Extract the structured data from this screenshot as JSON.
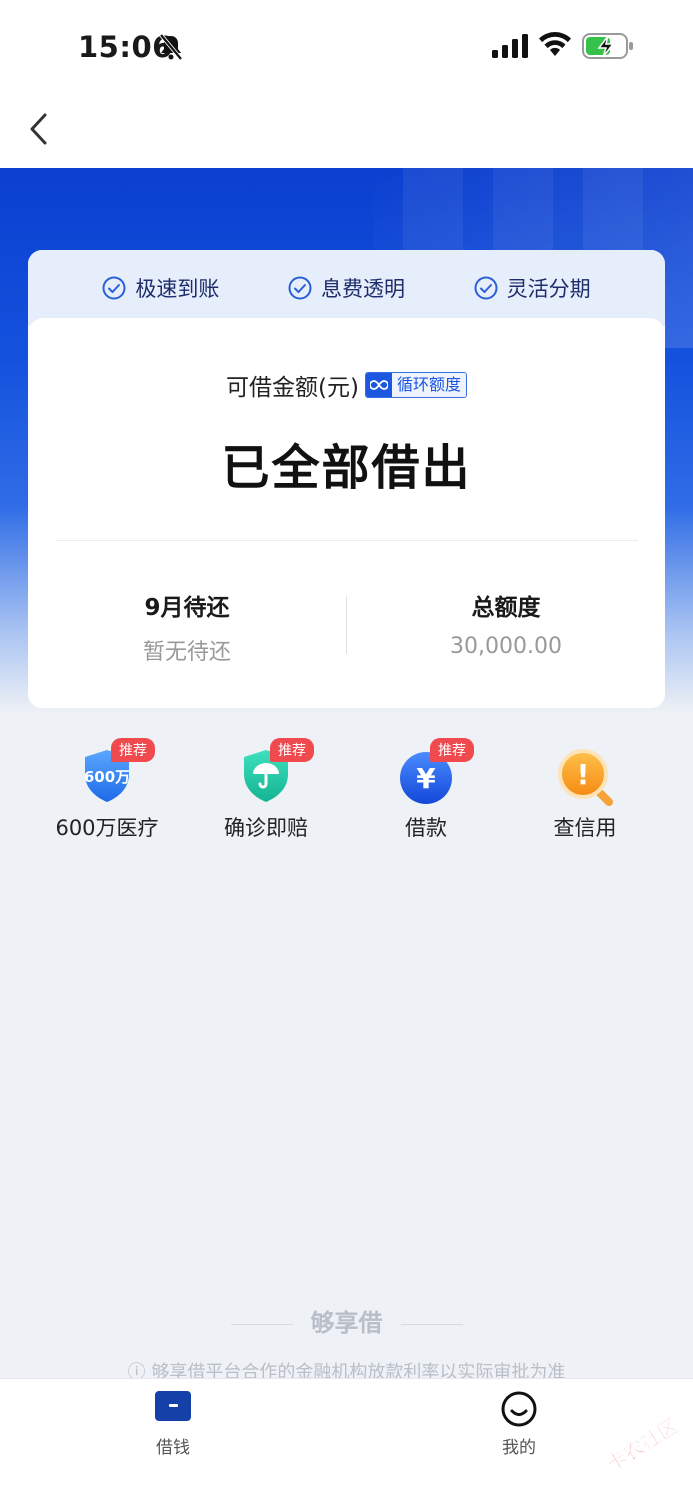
{
  "status_bar": {
    "time": "15:06"
  },
  "features": [
    {
      "label": "极速到账"
    },
    {
      "label": "息费透明"
    },
    {
      "label": "灵活分期"
    }
  ],
  "card": {
    "amount_label": "可借金额(元)",
    "cycle_badge": "循环额度",
    "amount_status": "已全部借出",
    "due": {
      "title": "9月待还",
      "value": "暂无待还"
    },
    "total": {
      "title": "总额度",
      "value": "30,000.00"
    }
  },
  "shortcuts": [
    {
      "label": "600万医疗",
      "badge": "推荐",
      "icon": "medical-shield-icon",
      "icon_text": "600万"
    },
    {
      "label": "确诊即赔",
      "badge": "推荐",
      "icon": "umbrella-shield-icon"
    },
    {
      "label": "借款",
      "badge": "推荐",
      "icon": "yuan-coin-icon",
      "icon_text": "¥"
    },
    {
      "label": "查信用",
      "icon": "credit-search-icon",
      "icon_text": "!"
    }
  ],
  "footer": {
    "brand": "够享借",
    "disclaimer": "够享借平台合作的金融机构放款利率以实际审批为准"
  },
  "tabbar": [
    {
      "label": "借钱"
    },
    {
      "label": "我的"
    }
  ],
  "watermark": "卡农社区",
  "colors": {
    "primary": "#1452de",
    "badge": "#f04a4f",
    "teal": "#1fc3a2",
    "orange": "#f59a1a"
  }
}
